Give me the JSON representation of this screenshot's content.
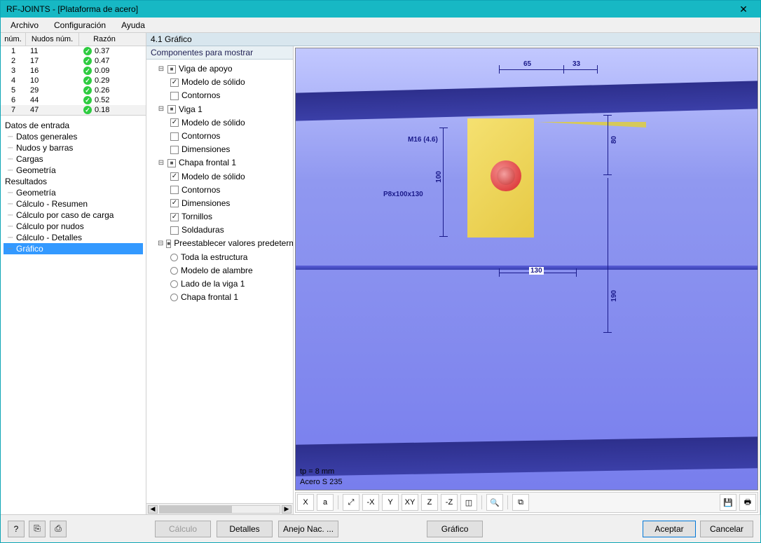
{
  "window": {
    "title": "RF-JOINTS - [Plataforma de acero]"
  },
  "menu": {
    "file": "Archivo",
    "config": "Configuración",
    "help": "Ayuda"
  },
  "table": {
    "headers": {
      "num": "núm.",
      "node": "Nudos núm.",
      "ratio": "Razón"
    },
    "rows": [
      {
        "num": "1",
        "node": "11",
        "ratio": "0.37"
      },
      {
        "num": "2",
        "node": "17",
        "ratio": "0.47"
      },
      {
        "num": "3",
        "node": "16",
        "ratio": "0.09"
      },
      {
        "num": "4",
        "node": "10",
        "ratio": "0.29"
      },
      {
        "num": "5",
        "node": "29",
        "ratio": "0.26"
      },
      {
        "num": "6",
        "node": "44",
        "ratio": "0.52"
      },
      {
        "num": "7",
        "node": "47",
        "ratio": "0.18"
      }
    ]
  },
  "nav": {
    "group1": "Datos de entrada",
    "g1": {
      "a": "Datos generales",
      "b": "Nudos y barras",
      "c": "Cargas",
      "d": "Geometría"
    },
    "group2": "Resultados",
    "g2": {
      "a": "Geometría",
      "b": "Cálculo - Resumen",
      "c": "Cálculo por caso de carga",
      "d": "Cálculo por nudos",
      "e": "Cálculo - Detalles",
      "f": "Gráfico"
    }
  },
  "section": {
    "title": "4.1 Gráfico"
  },
  "components": {
    "header": "Componentes para mostrar",
    "items": {
      "viga_apoyo": "Viga de apoyo",
      "modelo_solido": "Modelo de sólido",
      "contornos": "Contornos",
      "viga1": "Viga 1",
      "dimensiones": "Dimensiones",
      "chapa_frontal": "Chapa frontal 1",
      "tornillos": "Tornillos",
      "soldaduras": "Soldaduras",
      "preset": "Preestablecer valores predetermina",
      "toda": "Toda la estructura",
      "alambre": "Modelo de alambre",
      "lado_viga": "Lado de la viga 1",
      "chapa_f": "Chapa frontal 1"
    }
  },
  "viewport": {
    "dims": {
      "d65": "65",
      "d33": "33",
      "d80": "80",
      "d100": "100",
      "d130": "130",
      "d190": "190"
    },
    "labels": {
      "bolt": "M16 (4.6)",
      "plate": "P8x100x130"
    },
    "caption": {
      "line1": "tp = 8 mm",
      "line2": "Acero S 235"
    }
  },
  "toolbar": {
    "axes_x": "X",
    "axes_a": "a",
    "zoom_all": "⤢",
    "view_xz": "-X",
    "view_y": "Y",
    "view_xy": "XY",
    "view_z": "Z",
    "view_nz": "-Z",
    "iso": "◫",
    "mag": "🔍",
    "layers": "⧉",
    "save": "💾",
    "print": "🖶"
  },
  "buttons": {
    "help": "?",
    "calc": "Cálculo",
    "details": "Detalles",
    "annex": "Anejo Nac. ...",
    "grafico": "Gráfico",
    "ok": "Aceptar",
    "cancel": "Cancelar"
  }
}
